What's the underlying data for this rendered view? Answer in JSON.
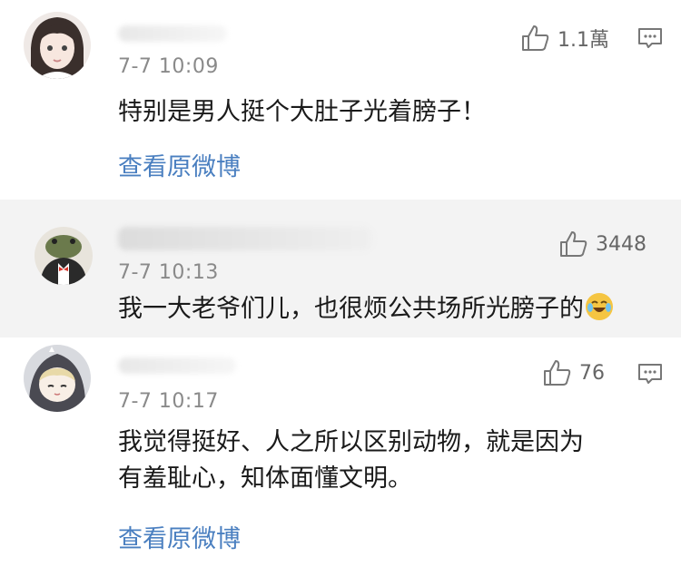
{
  "comments": [
    {
      "time": "7-7 10:09",
      "text": "特别是男人挺个大肚子光着膀子！",
      "likes": "1.1萬",
      "link": "查看原微博"
    },
    {
      "time": "7-7 10:13",
      "text": "我一大老爷们儿，也很烦公共场所光膀子的",
      "likes": "3448"
    },
    {
      "time": "7-7 10:17",
      "text_line1": "我觉得挺好、人之所以区别动物，就是因为",
      "text_line2": "有羞耻心，知体面懂文明。",
      "likes": "76",
      "link": "查看原微博"
    }
  ],
  "colors": {
    "link": "#4a7fc0",
    "muted": "#8a8a8a",
    "highlight_bg": "#f3f3f3"
  },
  "icons": [
    "thumbs-up-icon",
    "comment-icon",
    "laughing-crying-emoji"
  ]
}
